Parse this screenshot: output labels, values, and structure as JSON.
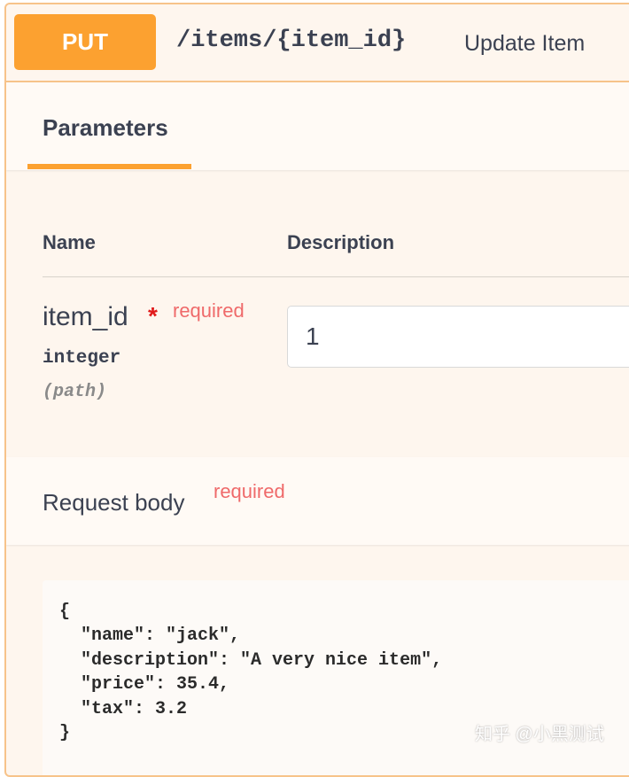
{
  "operation": {
    "method": "PUT",
    "path": "/items/{item_id}",
    "summary": "Update Item"
  },
  "tabs": {
    "active": "Parameters"
  },
  "parameters_table": {
    "headers": {
      "name": "Name",
      "description": "Description"
    },
    "rows": [
      {
        "name": "item_id",
        "required_marker": "*",
        "required_label": "required",
        "type": "integer",
        "location": "(path)",
        "value": "1"
      }
    ]
  },
  "request_body": {
    "title": "Request body",
    "required_label": "required",
    "code": "{\n  \"name\": \"jack\",\n  \"description\": \"A very nice item\",\n  \"price\": 35.4,\n  \"tax\": 3.2\n}"
  },
  "watermark": "知乎 @小黑测试",
  "colors": {
    "method_put": "#fca130",
    "panel_background": "#fef6ee",
    "panel_border": "#f7c38a",
    "required_text": "#ef6a6a",
    "required_star": "#e11a1a"
  }
}
